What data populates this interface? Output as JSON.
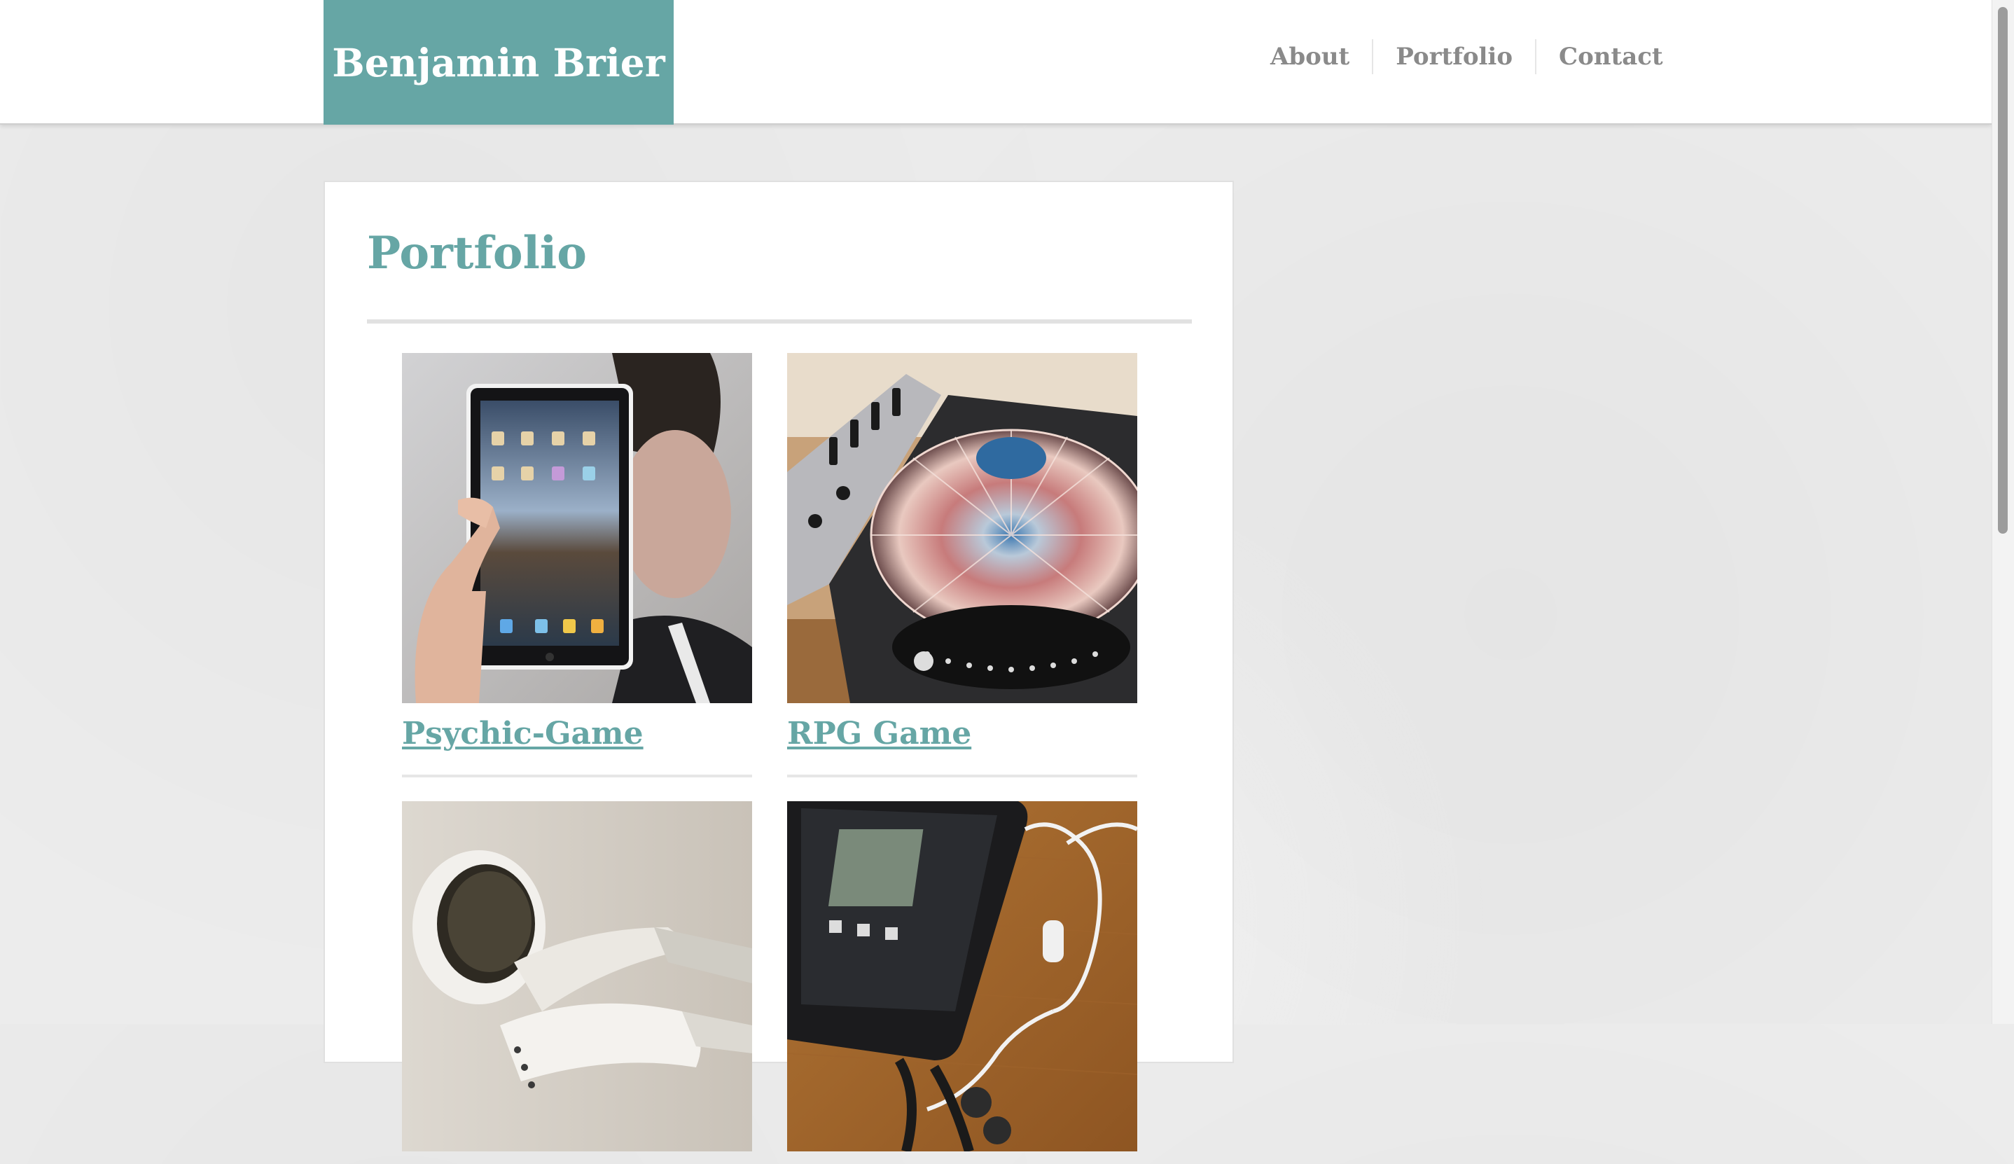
{
  "site": {
    "name": "Benjamin Brier"
  },
  "nav": {
    "items": [
      {
        "label": "About"
      },
      {
        "label": "Portfolio"
      },
      {
        "label": "Contact"
      }
    ]
  },
  "colors": {
    "accent": "#66a6a5",
    "nav_text": "#8a8a8a",
    "background": "#ececec"
  },
  "page": {
    "title": "Portfolio"
  },
  "portfolio": {
    "items": [
      {
        "title": "Psychic-Game",
        "image": "person-holding-tablet"
      },
      {
        "title": "RPG Game",
        "image": "dj-turntable"
      },
      {
        "title": "",
        "image": "earbuds-closeup"
      },
      {
        "title": "",
        "image": "phone-with-earphones"
      }
    ]
  }
}
